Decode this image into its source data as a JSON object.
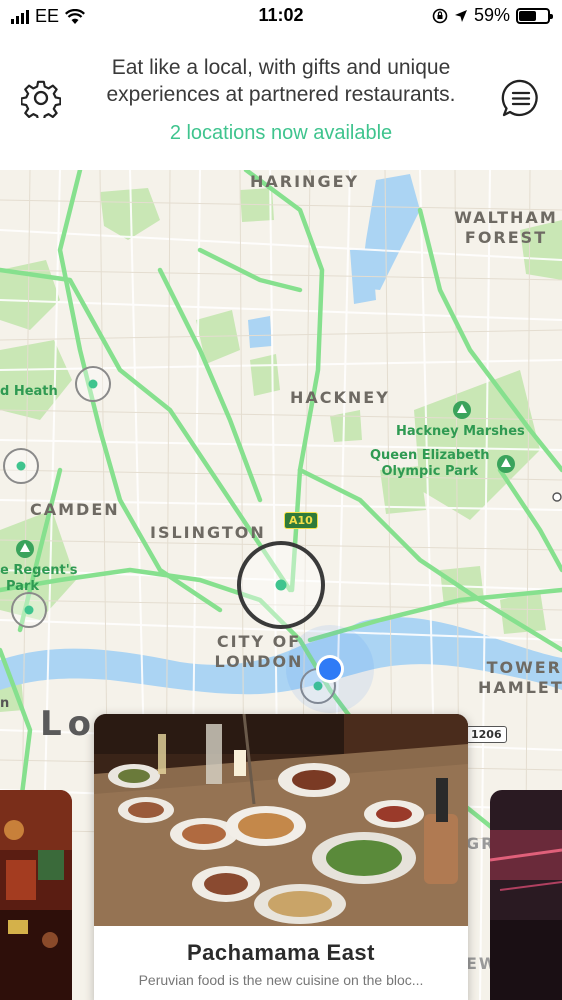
{
  "status_bar": {
    "carrier": "EE",
    "time": "11:02",
    "battery_percent": "59%",
    "battery_level": 0.59,
    "icons": [
      "signal-icon",
      "wifi-icon",
      "orientation-lock-icon",
      "location-arrow-icon",
      "battery-icon"
    ]
  },
  "header": {
    "tagline_line1": "Eat like a local, with gifts and unique",
    "tagline_line2": "experiences at partnered restaurants.",
    "available_text": "2 locations now available",
    "settings_icon": "gear-icon",
    "menu_icon": "chat-menu-icon"
  },
  "map": {
    "districts": {
      "haringey": "HARINGEY",
      "waltham_forest_1": "WALTHAM",
      "waltham_forest_2": "FOREST",
      "hackney": "HACKNEY",
      "camden": "CAMDEN",
      "islington": "ISLINGTON",
      "city_of_london_1": "CITY OF",
      "city_of_london_2": "LONDON",
      "tower_hamlets_1": "TOWER",
      "tower_hamlets_2": "HAMLET"
    },
    "parks": {
      "heath": "d Heath",
      "hackney_marshes": "Hackney Marshes",
      "olympic_park_1": "Queen Elizabeth",
      "olympic_park_2": "Olympic Park",
      "regents_park_1": "e Regent's",
      "regents_park_2": "Park"
    },
    "city_label": "Lo",
    "edge_label_left": "n",
    "edge_label_gr": "GR",
    "edge_label_ew": "EW",
    "roads": {
      "a10": "A10",
      "a1206": "1206"
    },
    "colors": {
      "land": "#f5f2ea",
      "park": "#c8e6b4",
      "water": "#aad3f2",
      "route": "#7fe08a",
      "accent": "#3fc48e",
      "user_location": "#2f7bf6"
    }
  },
  "cards": {
    "main": {
      "title": "Pachamama East",
      "description": "Peruvian food is the new cuisine on the bloc..."
    }
  }
}
